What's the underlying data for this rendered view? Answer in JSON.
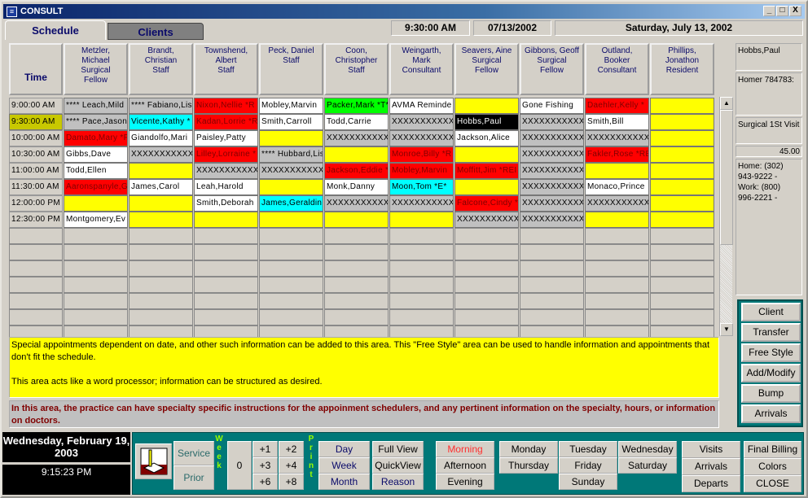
{
  "window": {
    "title": "CONSULT",
    "minimize": "_",
    "maximize": "□",
    "close": "X"
  },
  "tabs": [
    {
      "label": "Schedule",
      "active": true
    },
    {
      "label": "Clients",
      "active": false
    }
  ],
  "header": {
    "time": "9:30:00 AM",
    "date": "07/13/2002",
    "long_date": "Saturday, July 13, 2002"
  },
  "schedule": {
    "time_header": "Time",
    "providers": [
      {
        "name": "Metzler,\nMichael\nSurgical\nFellow"
      },
      {
        "name": "Brandt,\nChristian\nStaff"
      },
      {
        "name": "Townshend,\nAlbert\nStaff"
      },
      {
        "name": "Peck, Daniel\nStaff"
      },
      {
        "name": "Coon,\nChristopher\nStaff"
      },
      {
        "name": "Weingarth,\nMark\nConsultant"
      },
      {
        "name": "Seavers, Aine\nSurgical\nFellow"
      },
      {
        "name": "Gibbons, Geoff\nSurgical\nFellow"
      },
      {
        "name": "Outland,\nBooker\nConsultant"
      },
      {
        "name": "Phillips,\nJonathon\nResident"
      }
    ],
    "times": [
      "9:00:00 AM",
      "9:30:00 AM",
      "10:00:00 AM",
      "10:30:00 AM",
      "11:00:00 AM",
      "11:30:00 AM",
      "12:00:00 PM",
      "12:30:00 PM"
    ],
    "selected_time_index": 1,
    "rows": [
      [
        {
          "t": "**** Leach,Mild",
          "c": "gray"
        },
        {
          "t": "**** Fabiano,Lis",
          "c": "gray"
        },
        {
          "t": "Nixon,Nellie *R",
          "c": "red"
        },
        {
          "t": "Mobley,Marvin",
          "c": "white"
        },
        {
          "t": "Packer,Mark *T*",
          "c": "green"
        },
        {
          "t": "AVMA Reminde",
          "c": "white"
        },
        {
          "t": "",
          "c": "yellow"
        },
        {
          "t": "Gone Fishing",
          "c": "white"
        },
        {
          "t": "Daehler,Kelly *",
          "c": "red"
        },
        {
          "t": "",
          "c": "yellow"
        }
      ],
      [
        {
          "t": "**** Pace,Jason",
          "c": "gray"
        },
        {
          "t": "Vicente,Kathy *",
          "c": "cyan"
        },
        {
          "t": "Kadan,Lorrie *R",
          "c": "red"
        },
        {
          "t": "Smith,Carroll",
          "c": "white"
        },
        {
          "t": "Todd,Carrie",
          "c": "white"
        },
        {
          "t": "XXXXXXXXXXX",
          "c": "gray"
        },
        {
          "t": "Hobbs,Paul",
          "c": "black"
        },
        {
          "t": "XXXXXXXXXXX",
          "c": "gray"
        },
        {
          "t": "Smith,Bill",
          "c": "white"
        },
        {
          "t": "",
          "c": "yellow"
        }
      ],
      [
        {
          "t": "Damato,Mary *F",
          "c": "red"
        },
        {
          "t": "Giandolfo,Mari",
          "c": "white"
        },
        {
          "t": "Paisley,Patty",
          "c": "white"
        },
        {
          "t": "",
          "c": "yellow"
        },
        {
          "t": "XXXXXXXXXXX",
          "c": "gray"
        },
        {
          "t": "XXXXXXXXXXX",
          "c": "gray"
        },
        {
          "t": "Jackson,Alice",
          "c": "white"
        },
        {
          "t": "XXXXXXXXXXX",
          "c": "gray"
        },
        {
          "t": "XXXXXXXXXXX",
          "c": "gray"
        },
        {
          "t": "",
          "c": "yellow"
        }
      ],
      [
        {
          "t": "Gibbs,Dave",
          "c": "white"
        },
        {
          "t": "XXXXXXXXXXX",
          "c": "gray"
        },
        {
          "t": "Lilley,Lorraine *",
          "c": "red"
        },
        {
          "t": "**** Hubbard,Lis",
          "c": "gray"
        },
        {
          "t": "",
          "c": "yellow"
        },
        {
          "t": "Monroe,Billy *R",
          "c": "red"
        },
        {
          "t": "",
          "c": "yellow"
        },
        {
          "t": "XXXXXXXXXXX",
          "c": "gray"
        },
        {
          "t": "Fakler,Rose *RE",
          "c": "red"
        },
        {
          "t": "",
          "c": "yellow"
        }
      ],
      [
        {
          "t": "Todd,Ellen",
          "c": "white"
        },
        {
          "t": "",
          "c": "yellow"
        },
        {
          "t": "XXXXXXXXXXX",
          "c": "gray"
        },
        {
          "t": "XXXXXXXXXXX",
          "c": "gray"
        },
        {
          "t": "Jackson,Eddie *",
          "c": "red"
        },
        {
          "t": "Mobley,Marvin",
          "c": "red"
        },
        {
          "t": "Moffitt,Jim *REI",
          "c": "red"
        },
        {
          "t": "XXXXXXXXXXX",
          "c": "gray"
        },
        {
          "t": "",
          "c": "yellow"
        },
        {
          "t": "",
          "c": "yellow"
        }
      ],
      [
        {
          "t": "Aaronspanyle,G",
          "c": "red"
        },
        {
          "t": "James,Carol",
          "c": "white"
        },
        {
          "t": "Leah,Harold",
          "c": "white"
        },
        {
          "t": "",
          "c": "yellow"
        },
        {
          "t": "Monk,Danny",
          "c": "white"
        },
        {
          "t": "Moon,Tom *E*",
          "c": "cyan"
        },
        {
          "t": "",
          "c": "yellow"
        },
        {
          "t": "XXXXXXXXXXX",
          "c": "gray"
        },
        {
          "t": "Monaco,Prince",
          "c": "white"
        },
        {
          "t": "",
          "c": "yellow"
        }
      ],
      [
        {
          "t": "",
          "c": "yellow"
        },
        {
          "t": "",
          "c": "yellow"
        },
        {
          "t": "Smith,Deborah",
          "c": "white"
        },
        {
          "t": "James,Geraldin",
          "c": "cyan"
        },
        {
          "t": "XXXXXXXXXXX",
          "c": "gray"
        },
        {
          "t": "XXXXXXXXXXX",
          "c": "gray"
        },
        {
          "t": "Falcone,Cindy *",
          "c": "red"
        },
        {
          "t": "XXXXXXXXXXX",
          "c": "gray"
        },
        {
          "t": "XXXXXXXXXXX",
          "c": "gray"
        },
        {
          "t": "",
          "c": "yellow"
        }
      ],
      [
        {
          "t": "Montgomery,Ev",
          "c": "white"
        },
        {
          "t": "",
          "c": "yellow"
        },
        {
          "t": "",
          "c": "yellow"
        },
        {
          "t": "",
          "c": "yellow"
        },
        {
          "t": "",
          "c": "yellow"
        },
        {
          "t": "",
          "c": "yellow"
        },
        {
          "t": "XXXXXXXXXXX",
          "c": "gray"
        },
        {
          "t": "XXXXXXXXXXX",
          "c": "gray"
        },
        {
          "t": "",
          "c": "yellow"
        },
        {
          "t": "",
          "c": "yellow"
        }
      ]
    ]
  },
  "client_info": {
    "name": "Hobbs,Paul",
    "account": "Homer 784783:",
    "visit_type": "Surgical 1St Visit",
    "amount": "45.00",
    "phones": "Home: (302)\n943-9222 -\nWork: (800)\n996-2221 -"
  },
  "side_buttons": [
    "Client",
    "Transfer",
    "Free Style",
    "Add/Modify",
    "Bump",
    "Arrivals"
  ],
  "free_style_text": "Special appointments dependent on date, and other such information can be added to this area.  This \"Free Style\" area can be used to handle information and appointments that don't fit the schedule.\n\nThis area acts like a word processor; information can be structured as desired.",
  "instructions_text": "In this area, the practice can have specialty specific instructions for the appoinment schedulers, and any pertinent information on the specialty, hours, or information on doctors.",
  "footer": {
    "current_date": "Wednesday, February 19, 2003",
    "current_time": "9:15:23 PM",
    "service": "Service",
    "prior": "Prior",
    "week_label": "Week",
    "week_zero": "0",
    "week_offsets": [
      "+1",
      "+2",
      "+3",
      "+4",
      "+6",
      "+8"
    ],
    "print_label": "Print",
    "print_options": [
      "Day",
      "Week",
      "Month"
    ],
    "views": [
      "Full View",
      "QuickView",
      "Reason"
    ],
    "periods": [
      "Morning",
      "Afternoon",
      "Evening"
    ],
    "days": [
      "Monday",
      "Tuesday",
      "Wednesday",
      "Thursday",
      "Friday",
      "Saturday",
      "Sunday"
    ],
    "tracking": [
      "Visits",
      "Arrivals",
      "Departs"
    ],
    "misc": [
      "Final Billing",
      "Colors",
      "CLOSE"
    ],
    "active_period_color": "#ff3030"
  },
  "colors": {
    "teal": "#007878",
    "appointment_red": "#ff0000",
    "open_yellow": "#ffff00",
    "blocked_gray": "#c0c0c0"
  }
}
